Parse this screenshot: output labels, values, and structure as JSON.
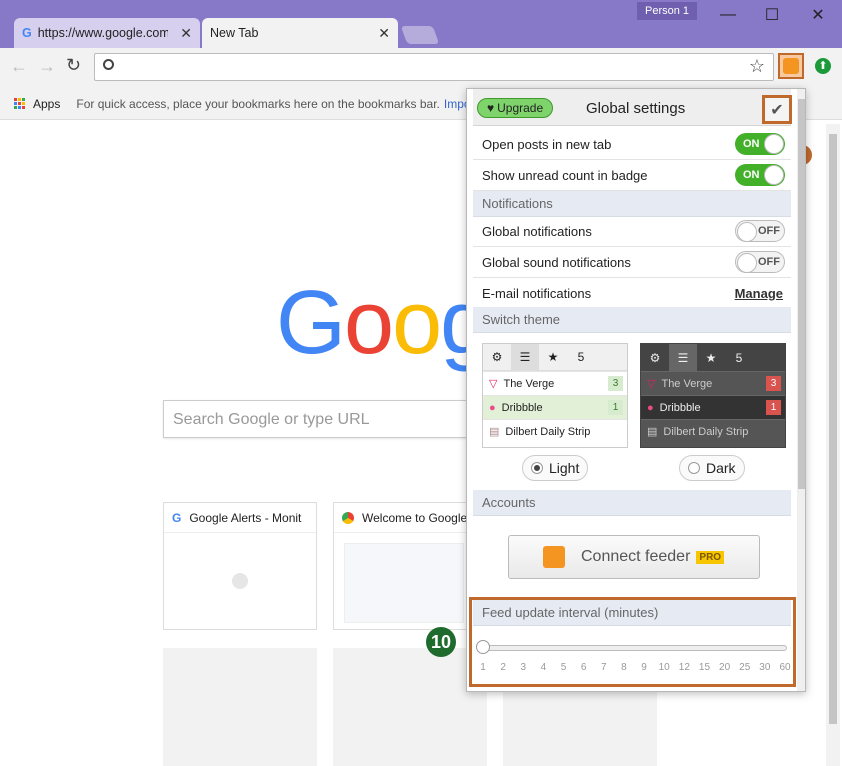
{
  "window": {
    "person": "Person 1",
    "min": "—",
    "max": "☐",
    "close": "✕"
  },
  "tabs": [
    {
      "title": "https://www.google.com",
      "close": "✕"
    },
    {
      "title": "New Tab",
      "close": "✕"
    }
  ],
  "toolbar": {
    "back": "←",
    "forward": "→",
    "reload": "↻",
    "star": "☆"
  },
  "bookmarks": {
    "apps": "Apps",
    "hint": "For quick access, place your bookmarks here on the bookmarks bar.",
    "more": "Impo"
  },
  "page": {
    "logo": [
      "G",
      "o",
      "o",
      "g"
    ],
    "search_placeholder": "Search Google or type URL",
    "most_visited": [
      {
        "title": "Google Alerts - Monit"
      },
      {
        "title": "Welcome to Google"
      }
    ],
    "callout_number": "10"
  },
  "popup": {
    "upgrade": "Upgrade",
    "title": "Global settings",
    "check": "✔",
    "settings": [
      {
        "label": "Open posts in new tab",
        "state": "ON"
      },
      {
        "label": "Show unread count in badge",
        "state": "ON"
      }
    ],
    "notifications_header": "Notifications",
    "notifications": [
      {
        "label": "Global notifications",
        "state": "OFF"
      },
      {
        "label": "Global sound notifications",
        "state": "OFF"
      }
    ],
    "email": {
      "label": "E-mail notifications",
      "link": "Manage"
    },
    "theme_header": "Switch theme",
    "theme_feeds": [
      {
        "name": "The Verge",
        "count": "3"
      },
      {
        "name": "Dribbble",
        "count": "1"
      },
      {
        "name": "Dilbert Daily Strip",
        "count": ""
      }
    ],
    "theme_tab_count": "5",
    "themes": [
      {
        "label": "Light",
        "selected": true
      },
      {
        "label": "Dark",
        "selected": false
      }
    ],
    "accounts_header": "Accounts",
    "connect": {
      "label": "Connect feeder",
      "badge": "PRO"
    },
    "interval": {
      "header": "Feed update interval (minutes)",
      "ticks": [
        "1",
        "2",
        "3",
        "4",
        "5",
        "6",
        "7",
        "8",
        "9",
        "10",
        "12",
        "15",
        "20",
        "25",
        "30",
        "60"
      ],
      "value": "1"
    }
  },
  "colors": {
    "accent_green": "#43b02a",
    "highlight": "#c0692c",
    "titlebar": "#8878c8"
  }
}
